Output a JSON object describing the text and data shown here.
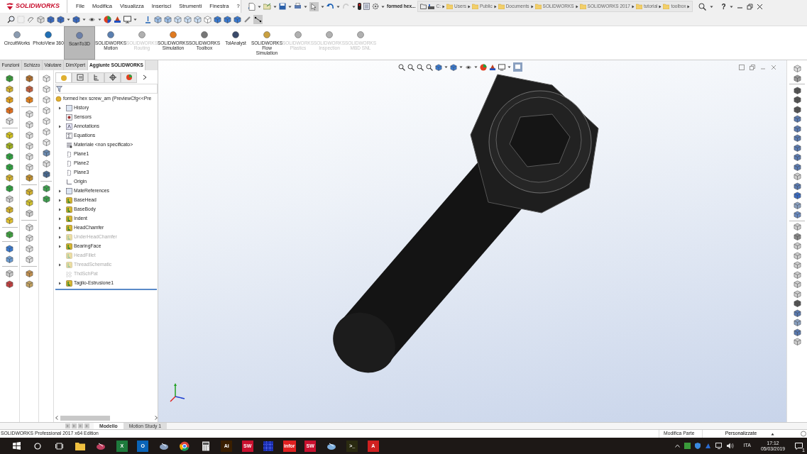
{
  "app": {
    "logo": "SOLIDWORKS"
  },
  "menu": [
    "File",
    "Modifica",
    "Visualizza",
    "Inserisci",
    "Strumenti",
    "Finestra",
    "?"
  ],
  "document_title": "formed hex...",
  "breadcrumb": [
    "C:",
    "Users",
    "Public",
    "Documents",
    "SOLIDWORKS",
    "SOLIDWORKS 2017",
    "tutorial",
    "toolbox"
  ],
  "help_label": "?",
  "command_manager": [
    {
      "label": "CircuitWorks",
      "disabled": false,
      "selected": false,
      "color": "#8a9bb0"
    },
    {
      "label": "PhotoView 360",
      "disabled": false,
      "selected": false,
      "color": "#1f6fb5"
    },
    {
      "label": "ScanTo3D",
      "disabled": false,
      "selected": true,
      "color": "#6b7fa8"
    },
    {
      "label": "SOLIDWORKS Motion",
      "disabled": false,
      "selected": false,
      "color": "#5a7fb0"
    },
    {
      "label": "SOLIDWORKS Routing",
      "disabled": true,
      "selected": false,
      "color": "#b0b0b0"
    },
    {
      "label": "SOLIDWORKS Simulation",
      "disabled": false,
      "selected": false,
      "color": "#e07a1f"
    },
    {
      "label": "SOLIDWORKS Toolbox",
      "disabled": false,
      "selected": false,
      "color": "#777777"
    },
    {
      "label": "TolAnalyst",
      "disabled": false,
      "selected": false,
      "color": "#3a4a6a"
    },
    {
      "label": "SOLIDWORKS Flow Simulation",
      "disabled": false,
      "selected": false,
      "color": "#c9a040"
    },
    {
      "label": "SOLIDWORKS Plastics",
      "disabled": true,
      "selected": false,
      "color": "#b0b0b0"
    },
    {
      "label": "SOLIDWORKS Inspection",
      "disabled": true,
      "selected": false,
      "color": "#b0b0b0"
    },
    {
      "label": "SOLIDWORKS MBD SNL",
      "disabled": true,
      "selected": false,
      "color": "#b0b0b0"
    }
  ],
  "tabs": [
    {
      "label": "Funzioni",
      "selected": false
    },
    {
      "label": "Schizzo",
      "selected": false
    },
    {
      "label": "Valutare",
      "selected": false
    },
    {
      "label": "DimXpert",
      "selected": false
    },
    {
      "label": "Aggiunte SOLIDWORKS",
      "selected": true
    }
  ],
  "feature_tree": {
    "root": "formed hex screw_am  (PreviewCfg<<Pre",
    "items": [
      {
        "label": "History",
        "kind": "folder",
        "expandable": true,
        "suppressed": false
      },
      {
        "label": "Sensors",
        "kind": "sensor",
        "expandable": false,
        "suppressed": false
      },
      {
        "label": "Annotations",
        "kind": "annotation",
        "expandable": true,
        "suppressed": false
      },
      {
        "label": "Equations",
        "kind": "equation",
        "expandable": false,
        "suppressed": false
      },
      {
        "label": "Materiale <non specificato>",
        "kind": "material",
        "expandable": false,
        "suppressed": false
      },
      {
        "label": "Plane1",
        "kind": "plane",
        "expandable": false,
        "suppressed": false
      },
      {
        "label": "Plane2",
        "kind": "plane",
        "expandable": false,
        "suppressed": false
      },
      {
        "label": "Plane3",
        "kind": "plane",
        "expandable": false,
        "suppressed": false
      },
      {
        "label": "Origin",
        "kind": "origin",
        "expandable": false,
        "suppressed": false
      },
      {
        "label": "MateReferences",
        "kind": "folder",
        "expandable": true,
        "suppressed": false
      },
      {
        "label": "BaseHead",
        "kind": "feature",
        "expandable": true,
        "suppressed": false
      },
      {
        "label": "BaseBody",
        "kind": "feature",
        "expandable": true,
        "suppressed": false
      },
      {
        "label": "Indent",
        "kind": "feature",
        "expandable": true,
        "suppressed": false
      },
      {
        "label": "HeadChamfer",
        "kind": "feature",
        "expandable": true,
        "suppressed": false
      },
      {
        "label": "UnderHeadChamfer",
        "kind": "feature",
        "expandable": true,
        "suppressed": true
      },
      {
        "label": "BearingFace",
        "kind": "feature",
        "expandable": true,
        "suppressed": false
      },
      {
        "label": "HeadFillet",
        "kind": "feature",
        "expandable": false,
        "suppressed": true
      },
      {
        "label": "ThreadSchematic",
        "kind": "feature",
        "expandable": true,
        "suppressed": true
      },
      {
        "label": "ThdSchPat",
        "kind": "pattern",
        "expandable": false,
        "suppressed": true
      },
      {
        "label": "Taglio-Estrusione1",
        "kind": "feature",
        "expandable": true,
        "suppressed": false
      }
    ]
  },
  "bottom_tabs": [
    {
      "label": "Modello",
      "selected": true
    },
    {
      "label": "Motion Study 1",
      "selected": false
    }
  ],
  "status_bar": {
    "text": "SOLIDWORKS Professional 2017 x64 Edition",
    "mode": "Modifica Parte",
    "units": "Personalizzate"
  },
  "taskbar": {
    "apps": [
      {
        "kind": "folder",
        "color": "#f0c040"
      },
      {
        "kind": "disc",
        "color": "#c04060"
      },
      {
        "kind": "tile",
        "color": "#1e7a3c",
        "label": "X"
      },
      {
        "kind": "tile",
        "color": "#0a64b8",
        "label": "O"
      },
      {
        "kind": "disc",
        "color": "#8aa0c0"
      },
      {
        "kind": "chrome",
        "color": "#db4437"
      },
      {
        "kind": "calc",
        "color": "#e0e0e0"
      },
      {
        "kind": "tile",
        "color": "#3a1f00",
        "label": "Ai"
      },
      {
        "kind": "tile",
        "color": "#c8102e",
        "label": "SW"
      },
      {
        "kind": "grid",
        "color": "#1a2fb0"
      },
      {
        "kind": "tile",
        "color": "#e02020",
        "label": "infor"
      },
      {
        "kind": "tile",
        "color": "#c8102e",
        "label": "SW"
      },
      {
        "kind": "disc",
        "color": "#7fb0e0"
      },
      {
        "kind": "tile",
        "color": "#2a2a10",
        "label": ">_"
      },
      {
        "kind": "tile",
        "color": "#d02020",
        "label": "A"
      }
    ],
    "language": "ITA",
    "time": "17:12",
    "date": "05/03/2019",
    "notifications": "1"
  }
}
